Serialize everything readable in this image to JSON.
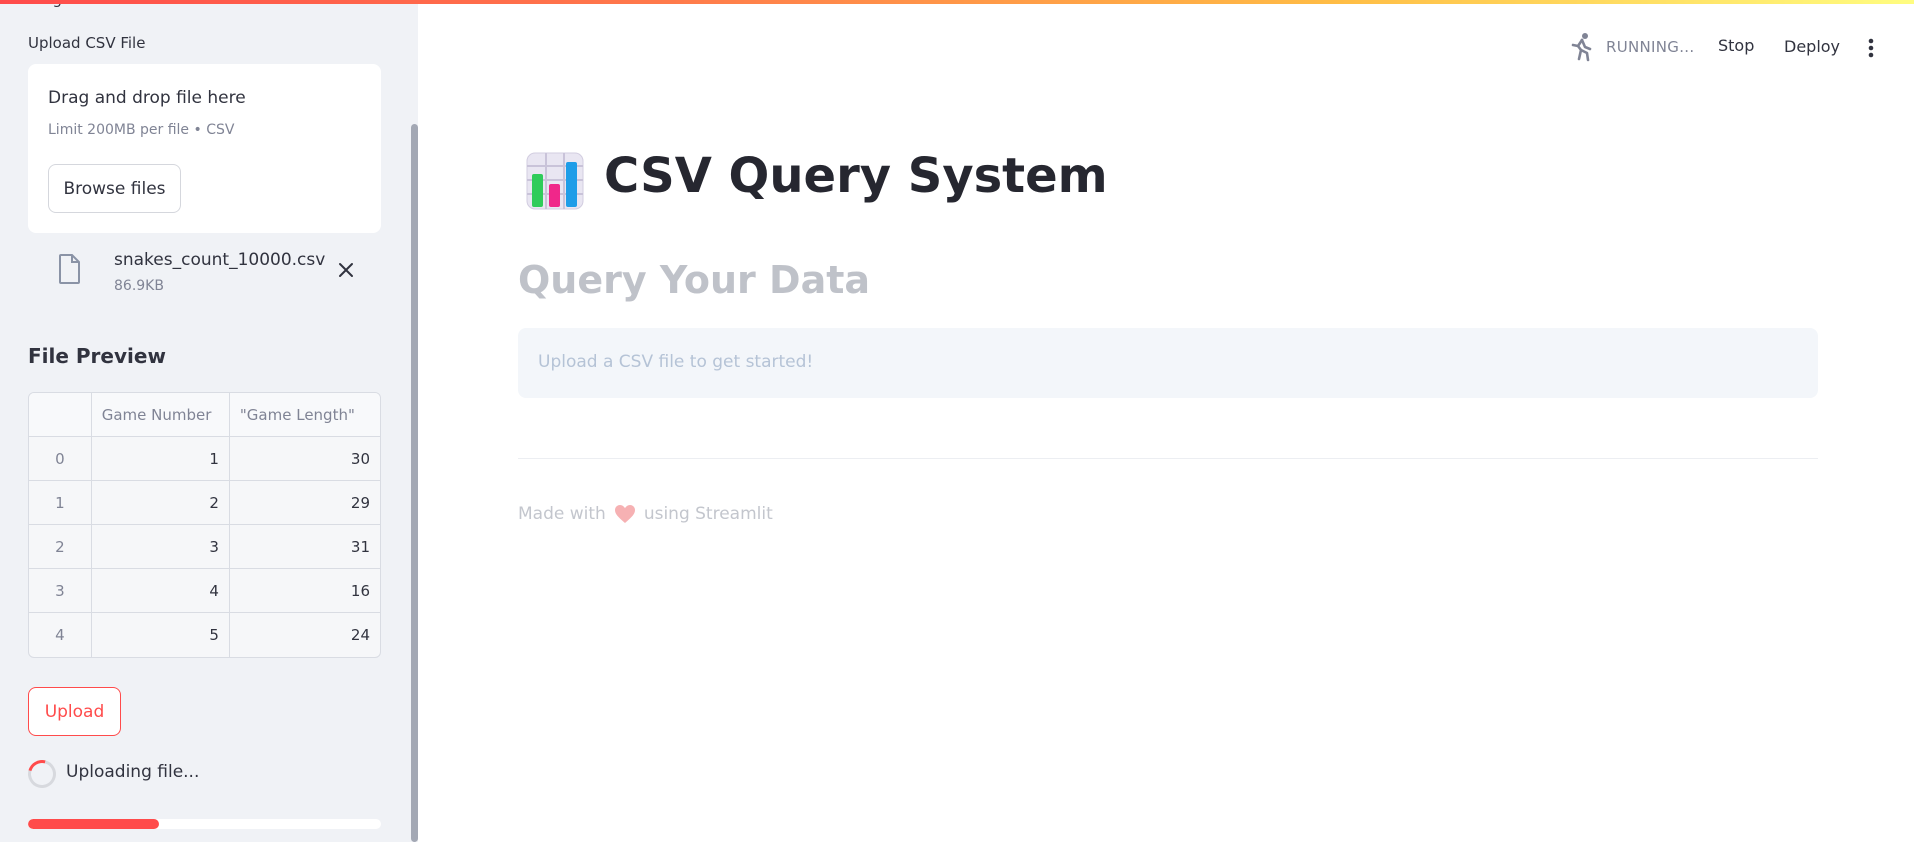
{
  "sidebar": {
    "clipped_text": "…ng",
    "upload_label": "Upload CSV File",
    "dropzone": {
      "title": "Drag and drop file here",
      "limit": "Limit 200MB per file • CSV",
      "browse_label": "Browse files"
    },
    "file": {
      "name": "snakes_count_10000.csv",
      "size": "86.9KB"
    },
    "preview_title": "File Preview",
    "table": {
      "columns": [
        "",
        "Game Number",
        "\"Game Length\""
      ],
      "rows": [
        [
          "0",
          "1",
          "30"
        ],
        [
          "1",
          "2",
          "29"
        ],
        [
          "2",
          "3",
          "31"
        ],
        [
          "3",
          "4",
          "16"
        ],
        [
          "4",
          "5",
          "24"
        ]
      ]
    },
    "upload_button": "Upload",
    "status_text": "Uploading file...",
    "progress_fraction": 0.37
  },
  "header": {
    "status": "RUNNING...",
    "stop_label": "Stop",
    "deploy_label": "Deploy"
  },
  "main": {
    "title": "CSV Query System",
    "subtitle": "Query Your Data",
    "info_message": "Upload a CSV file to get started!",
    "footer_prefix": "Made with",
    "footer_suffix": "using Streamlit"
  },
  "colors": {
    "accent": "#ff4b4b",
    "sidebar_bg": "#f0f2f6",
    "text": "#31333f",
    "muted": "#808495"
  },
  "icons": [
    "file-icon",
    "close-icon",
    "runner-icon",
    "more-vertical-icon",
    "bar-chart-icon",
    "heart-icon",
    "spinner-icon"
  ]
}
